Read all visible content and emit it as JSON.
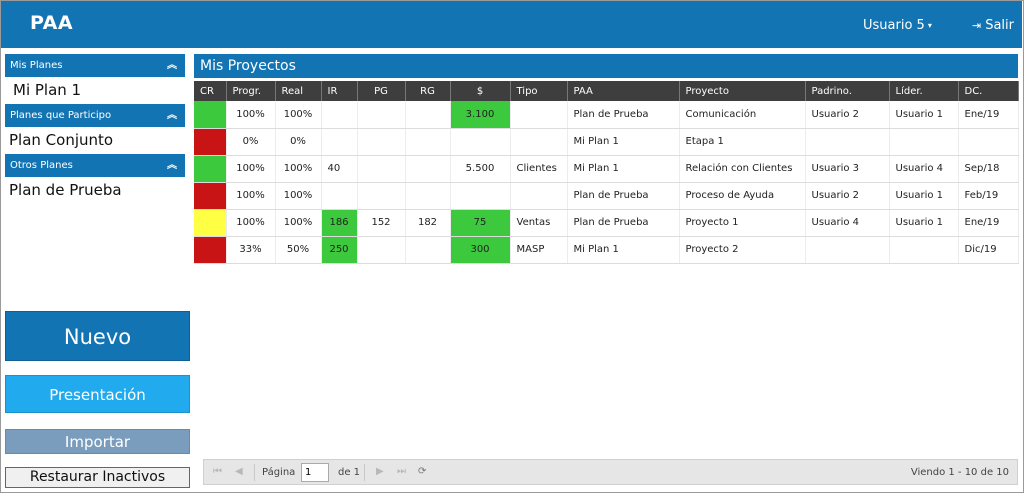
{
  "header": {
    "brand": "PAA",
    "user_label": "Usuario 5",
    "logout_label": "Salir"
  },
  "sidebar": {
    "sections": [
      {
        "title": "Mis Planes",
        "items": [
          "Mi Plan 1"
        ]
      },
      {
        "title": "Planes que Participo",
        "items": [
          "Plan Conjunto"
        ]
      },
      {
        "title": "Otros Planes",
        "items": [
          "Plan de Prueba"
        ]
      }
    ],
    "buttons": {
      "nuevo": "Nuevo",
      "presentacion": "Presentación",
      "importar": "Importar",
      "restaurar": "Restaurar Inactivos"
    }
  },
  "main": {
    "title": "Mis Proyectos",
    "columns": [
      "CR",
      "Progr.",
      "Real",
      "IR",
      "PG",
      "RG",
      "$",
      "Tipo",
      "PAA",
      "Proyecto",
      "Padrino.",
      "Líder.",
      "DC."
    ],
    "rows": [
      {
        "cr": "green",
        "progr": "100%",
        "real": "100%",
        "ir": "",
        "pg": "",
        "rg": "",
        "money": "3.100",
        "money_hl": true,
        "ir_hl": false,
        "tipo": "",
        "paa": "Plan de Prueba",
        "proyecto": "Comunicación",
        "padrino": "Usuario 2",
        "lider": "Usuario 1",
        "dc": "Ene/19"
      },
      {
        "cr": "red",
        "progr": "0%",
        "real": "0%",
        "ir": "",
        "pg": "",
        "rg": "",
        "money": "",
        "money_hl": false,
        "ir_hl": false,
        "tipo": "",
        "paa": "Mi Plan 1",
        "proyecto": "Etapa 1",
        "padrino": "",
        "lider": "",
        "dc": ""
      },
      {
        "cr": "green",
        "progr": "100%",
        "real": "100%",
        "ir": "40",
        "pg": "",
        "rg": "",
        "money": "5.500",
        "money_hl": false,
        "ir_hl": false,
        "tipo": "Clientes",
        "paa": "Mi Plan 1",
        "proyecto": "Relación con Clientes",
        "padrino": "Usuario 3",
        "lider": "Usuario 4",
        "dc": "Sep/18"
      },
      {
        "cr": "red",
        "progr": "100%",
        "real": "100%",
        "ir": "",
        "pg": "",
        "rg": "",
        "money": "",
        "money_hl": false,
        "ir_hl": false,
        "tipo": "",
        "paa": "Plan de Prueba",
        "proyecto": "Proceso de Ayuda",
        "padrino": "Usuario 2",
        "lider": "Usuario 1",
        "dc": "Feb/19"
      },
      {
        "cr": "yellow",
        "progr": "100%",
        "real": "100%",
        "ir": "186",
        "pg": "152",
        "rg": "182",
        "money": "75",
        "money_hl": true,
        "ir_hl": true,
        "tipo": "Ventas",
        "paa": "Plan de Prueba",
        "proyecto": "Proyecto 1",
        "padrino": "Usuario 4",
        "lider": "Usuario 1",
        "dc": "Ene/19"
      },
      {
        "cr": "red",
        "progr": "33%",
        "real": "50%",
        "ir": "250",
        "pg": "",
        "rg": "",
        "money": "300",
        "money_hl": true,
        "ir_hl": true,
        "tipo": "MASP",
        "paa": "Mi Plan 1",
        "proyecto": "Proyecto 2",
        "padrino": "",
        "lider": "",
        "dc": "Dic/19"
      }
    ]
  },
  "pager": {
    "page_label": "Página",
    "page_value": "1",
    "of_label": "de 1",
    "view_text": "Viendo 1 - 10 de 10"
  },
  "colors": {
    "header": "#1374b4",
    "green": "#3dc93d",
    "red": "#c81414",
    "yellow": "#ffff44"
  }
}
